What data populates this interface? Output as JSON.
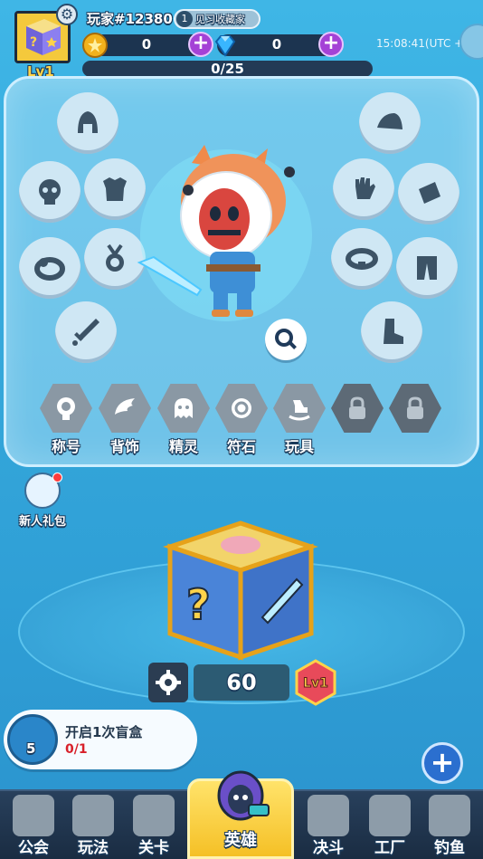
{
  "player": {
    "name": "玩家#12380",
    "level": "Lv1",
    "title_rank": "1",
    "title_name": "见习收藏家"
  },
  "currency": {
    "gold": "0",
    "gems": "0"
  },
  "clock": "15:08:41(UTC +8)",
  "xp": {
    "text": "0/25",
    "fraction": 0
  },
  "categories": [
    {
      "label": "称号",
      "locked": false
    },
    {
      "label": "背饰",
      "locked": false
    },
    {
      "label": "精灵",
      "locked": false
    },
    {
      "label": "符石",
      "locked": false
    },
    {
      "label": "玩具",
      "locked": false
    },
    {
      "label": "",
      "locked": true
    },
    {
      "label": "",
      "locked": true
    }
  ],
  "equipment_slots": {
    "left": [
      "helmet-icon",
      "skull-icon",
      "armor-icon",
      "ring-icon",
      "medal-icon",
      "sword-icon"
    ],
    "right": [
      "hat-icon",
      "glove-icon",
      "cape-icon",
      "belt-icon",
      "pants-icon",
      "boot-icon"
    ]
  },
  "newbie_pack": {
    "label": "新人礼包"
  },
  "blind_box": {
    "count": "60",
    "level": "Lv1"
  },
  "quest": {
    "icon_badge": "5",
    "title": "开启1次盲盒",
    "progress": "0/1"
  },
  "nav": [
    {
      "label": "公会"
    },
    {
      "label": "玩法"
    },
    {
      "label": "关卡"
    },
    {
      "label": "英雄"
    },
    {
      "label": "决斗"
    },
    {
      "label": "工厂"
    },
    {
      "label": "钓鱼"
    }
  ],
  "colors": {
    "background": "#35a8db",
    "gold": "#ffd34a",
    "gem_plus": "#a442d6",
    "quest_progress": "#d8202a",
    "nav_active": "#f5c026"
  }
}
